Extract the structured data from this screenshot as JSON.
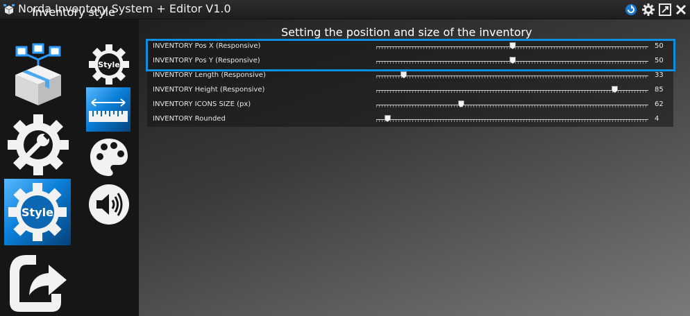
{
  "window": {
    "title": "Norda Inventory System + Editor V1.0",
    "accent_color": "#0e8ede"
  },
  "title_buttons": [
    {
      "name": "refresh-icon"
    },
    {
      "name": "gear-icon"
    },
    {
      "name": "maximize-icon"
    },
    {
      "name": "close-icon"
    }
  ],
  "sidebar": {
    "heading": "Inventory style",
    "main_items": [
      {
        "name": "inventory-box-icon",
        "active": false
      },
      {
        "name": "wrench-gear-icon",
        "active": false
      },
      {
        "name": "style-gear-icon",
        "label": "Style",
        "active": true
      },
      {
        "name": "export-icon",
        "active": false
      }
    ],
    "sub_items": [
      {
        "name": "style-gear-icon",
        "label": "Style",
        "active": false
      },
      {
        "name": "size-ruler-icon",
        "active": true
      },
      {
        "name": "palette-icon",
        "active": false
      },
      {
        "name": "sound-icon",
        "active": false
      }
    ]
  },
  "main": {
    "heading": "Setting the position and size of the inventory",
    "settings": [
      {
        "label": "INVENTORY Pos X (Responsive)",
        "value": 50,
        "fraction": 0.5
      },
      {
        "label": "INVENTORY Pos Y (Responsive)",
        "value": 50,
        "fraction": 0.5
      },
      {
        "label": "INVENTORY Length (Responsive)",
        "value": 33,
        "fraction": 0.1
      },
      {
        "label": "INVENTORY Height (Responsive)",
        "value": 85,
        "fraction": 0.875
      },
      {
        "label": "INVENTORY ICONS SIZE (px)",
        "value": 62,
        "fraction": 0.31
      },
      {
        "label": "INVENTORY Rounded",
        "value": 4,
        "fraction": 0.04
      }
    ]
  }
}
